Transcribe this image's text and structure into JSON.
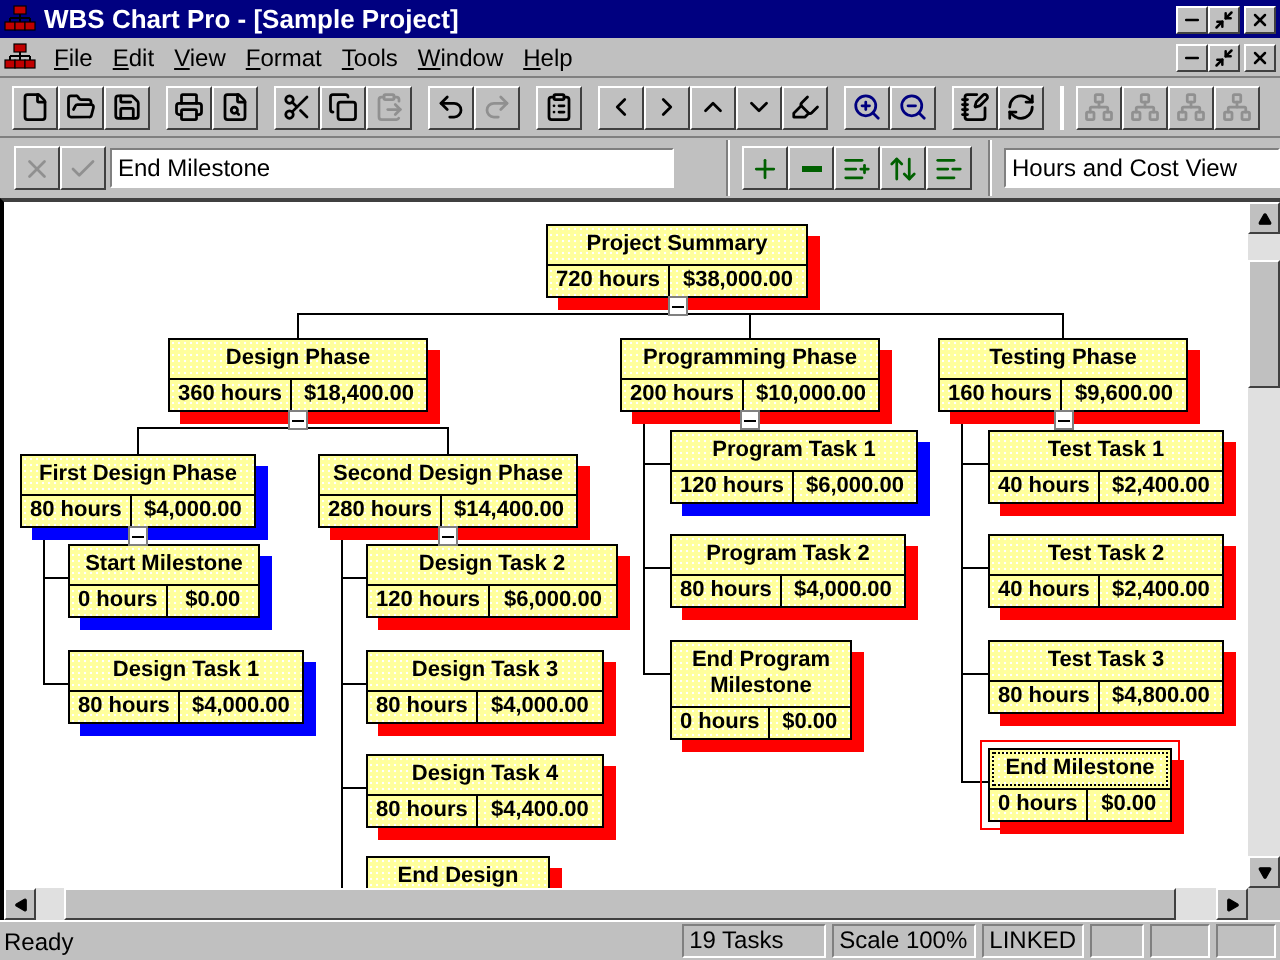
{
  "window": {
    "title": "WBS Chart Pro - [Sample Project]"
  },
  "menu": [
    "File",
    "Edit",
    "View",
    "Format",
    "Tools",
    "Window",
    "Help"
  ],
  "toolbar": {
    "groups": [
      [
        {
          "disabled": false
        },
        {
          "disabled": false
        },
        {
          "disabled": false
        }
      ],
      [
        {
          "disabled": false
        },
        {
          "disabled": false
        }
      ],
      [
        {
          "disabled": false
        },
        {
          "disabled": false
        },
        {
          "disabled": true
        }
      ],
      [
        {
          "disabled": false
        },
        {
          "disabled": true
        }
      ],
      [
        {
          "disabled": false
        }
      ],
      [
        {
          "disabled": false
        },
        {
          "disabled": false
        },
        {
          "disabled": false
        },
        {
          "disabled": false
        },
        {
          "disabled": false
        }
      ],
      [
        {
          "disabled": false
        },
        {
          "disabled": false
        }
      ],
      [
        {
          "disabled": false
        },
        {
          "disabled": false
        }
      ],
      [
        {
          "disabled": true
        },
        {
          "disabled": true
        },
        {
          "disabled": true
        },
        {
          "disabled": true
        }
      ]
    ]
  },
  "edit_bar": {
    "cancel_disabled": true,
    "accept_disabled": true,
    "task_name": "End Milestone",
    "view": "Hours and Cost View"
  },
  "chart": {
    "root": {
      "title": "Project Summary",
      "hours": "720 hours",
      "cost": "$38,000.00",
      "color": "#ff0000",
      "selected": false,
      "expanded": true,
      "children": [
        {
          "title": "Design Phase",
          "hours": "360 hours",
          "cost": "$18,400.00",
          "color": "#ff0000",
          "selected": false,
          "expanded": true,
          "children": [
            {
              "title": "First Design Phase",
              "hours": "80 hours",
              "cost": "$4,000.00",
              "color": "#0000ff",
              "selected": false,
              "expanded": true,
              "children": [
                {
                  "title": "Start Milestone",
                  "hours": "0 hours",
                  "cost": "$0.00",
                  "color": "#0000ff",
                  "selected": false
                },
                {
                  "title": "Design Task 1",
                  "hours": "80 hours",
                  "cost": "$4,000.00",
                  "color": "#0000ff",
                  "selected": false
                }
              ]
            },
            {
              "title": "Second Design Phase",
              "hours": "280 hours",
              "cost": "$14,400.00",
              "color": "#ff0000",
              "selected": false,
              "expanded": true,
              "children": [
                {
                  "title": "Design Task 2",
                  "hours": "120 hours",
                  "cost": "$6,000.00",
                  "color": "#ff0000",
                  "selected": false
                },
                {
                  "title": "Design Task 3",
                  "hours": "80 hours",
                  "cost": "$4,000.00",
                  "color": "#ff0000",
                  "selected": false
                },
                {
                  "title": "Design Task 4",
                  "hours": "80 hours",
                  "cost": "$4,400.00",
                  "color": "#ff0000",
                  "selected": false
                },
                {
                  "title": "End Design",
                  "color": "#ff0000",
                  "selected": false
                }
              ]
            }
          ]
        },
        {
          "title": "Programming Phase",
          "hours": "200 hours",
          "cost": "$10,000.00",
          "color": "#ff0000",
          "selected": false,
          "expanded": true,
          "children": [
            {
              "title": "Program Task 1",
              "hours": "120 hours",
              "cost": "$6,000.00",
              "color": "#0000ff",
              "selected": false
            },
            {
              "title": "Program Task 2",
              "hours": "80 hours",
              "cost": "$4,000.00",
              "color": "#ff0000",
              "selected": false
            },
            {
              "title": "End Program Milestone",
              "hours": "0 hours",
              "cost": "$0.00",
              "color": "#ff0000",
              "selected": false
            }
          ]
        },
        {
          "title": "Testing Phase",
          "hours": "160 hours",
          "cost": "$9,600.00",
          "color": "#ff0000",
          "selected": false,
          "expanded": true,
          "children": [
            {
              "title": "Test Task 1",
              "hours": "40 hours",
              "cost": "$2,400.00",
              "color": "#ff0000",
              "selected": false
            },
            {
              "title": "Test Task 2",
              "hours": "40 hours",
              "cost": "$2,400.00",
              "color": "#ff0000",
              "selected": false
            },
            {
              "title": "Test Task 3",
              "hours": "80 hours",
              "cost": "$4,800.00",
              "color": "#ff0000",
              "selected": false
            },
            {
              "title": "End Milestone",
              "hours": "0 hours",
              "cost": "$0.00",
              "color": "#ff0000",
              "selected": true
            }
          ]
        }
      ]
    }
  },
  "status_bar": {
    "message": "Ready",
    "panels": [
      "19 Tasks",
      "Scale 100%",
      "LINKED"
    ]
  }
}
